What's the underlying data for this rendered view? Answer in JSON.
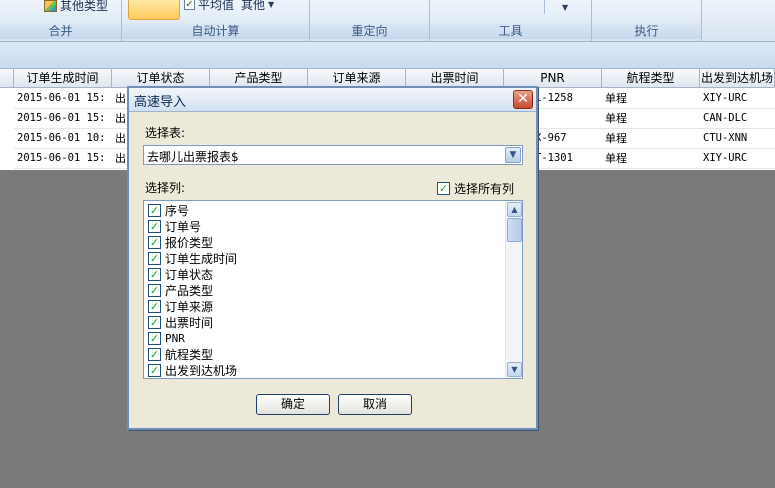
{
  "ribbon": {
    "other_type_label": "其他类型",
    "average_label": "平均值",
    "other_label": "其他",
    "groups": [
      "合并",
      "自动计算",
      "重定向",
      "工具",
      "执行"
    ]
  },
  "grid": {
    "columns": [
      "订单生成时间",
      "订单状态",
      "产品类型",
      "订单来源",
      "出票时间",
      "PNR",
      "航程类型",
      "出发到达机场"
    ],
    "rows": [
      {
        "time": "2015-06-01 15:",
        "status": "出",
        "pnr": "1-1258",
        "trip": "单程",
        "route": "XIY-URC"
      },
      {
        "time": "2015-06-01 15:",
        "status": "出",
        "pnr": "",
        "trip": "单程",
        "route": "CAN-DLC"
      },
      {
        "time": "2015-06-01 10:",
        "status": "出",
        "pnr": "X-967",
        "trip": "单程",
        "route": "CTU-XNN"
      },
      {
        "time": "2015-06-01 15:",
        "status": "出",
        "pnr": "T-1301",
        "trip": "单程",
        "route": "XIY-URC"
      }
    ]
  },
  "dialog": {
    "title": "高速导入",
    "select_table_label": "选择表:",
    "table_value": "去哪儿出票报表$",
    "select_columns_label": "选择列:",
    "select_all_label": "选择所有列",
    "columns": [
      "序号",
      "订单号",
      "报价类型",
      "订单生成时间",
      "订单状态",
      "产品类型",
      "订单来源",
      "出票时间",
      "PNR",
      "航程类型",
      "出发到达机场"
    ],
    "ok_label": "确定",
    "cancel_label": "取消"
  }
}
